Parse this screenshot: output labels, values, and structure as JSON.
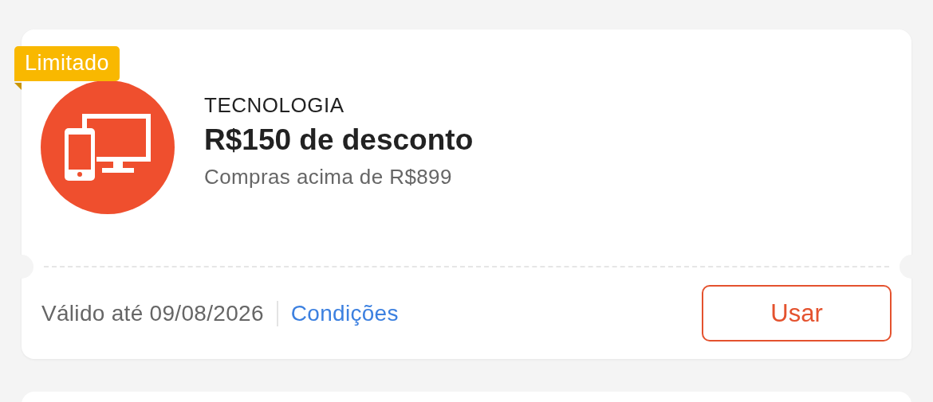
{
  "coupon": {
    "badge": "Limitado",
    "category": "TECNOLOGIA",
    "title": "R$150 de desconto",
    "condition": "Compras acima de R$899",
    "validity": "Válido até 09/08/2026",
    "terms_link": "Condições",
    "action_button": "Usar"
  }
}
